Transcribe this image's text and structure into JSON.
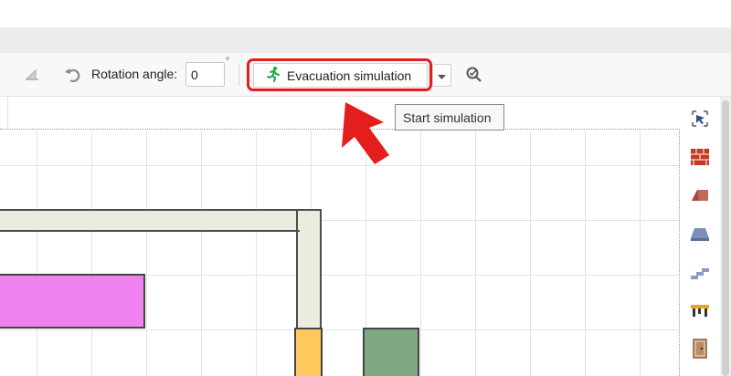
{
  "toolbar": {
    "rotation_label": "Rotation angle:",
    "rotation_value": "0",
    "degree_symbol": "°",
    "evacuation_button_label": "Evacuation simulation",
    "icons": [
      "flip-icon",
      "rotate-icon",
      "running-person-icon",
      "chevron-down-icon",
      "search-check-icon"
    ]
  },
  "tooltip": {
    "text": "Start simulation"
  },
  "right_panel": {
    "icons": [
      "select-icon",
      "wall-brick-icon",
      "roof-icon",
      "floor-slab-icon",
      "stairs-icon",
      "table-icon",
      "door-icon"
    ]
  },
  "colors": {
    "highlight": "#e41d1d",
    "accent_green": "#1aa84a",
    "magenta_area": "#ee82ee",
    "orange_area": "#ffc95e",
    "green_area": "#80a880",
    "wall_fill": "#ecebdf"
  }
}
